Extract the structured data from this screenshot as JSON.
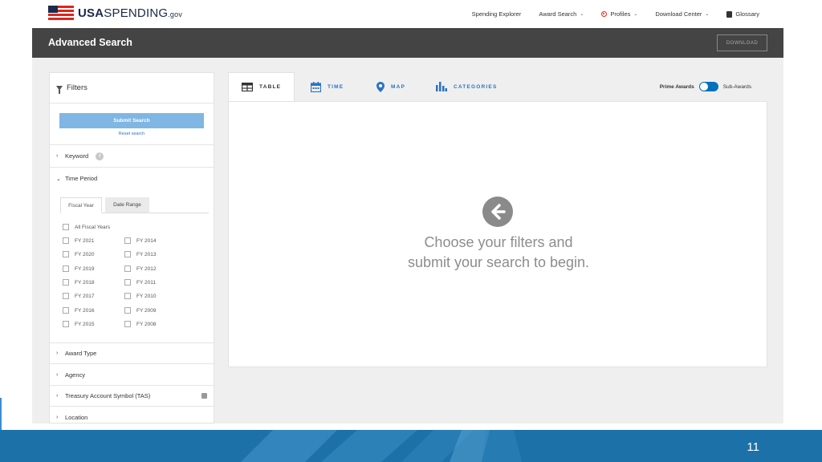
{
  "brand": {
    "bold": "USA",
    "name": "SPENDING",
    "tld": ".gov"
  },
  "nav": {
    "spending_explorer": "Spending Explorer",
    "award_search": "Award Search",
    "profiles": "Profiles",
    "download_center": "Download Center",
    "glossary": "Glossary"
  },
  "header": {
    "title": "Advanced Search",
    "download": "DOWNLOAD"
  },
  "sidebar": {
    "title": "Filters",
    "submit": "Submit Search",
    "reset": "Reset search",
    "keyword": "Keyword",
    "time_period": "Time Period",
    "tabs": {
      "fiscal_year": "Fiscal Year",
      "date_range": "Date Range"
    },
    "all_fy": "All Fiscal Years",
    "fy_left": [
      "FY 2021",
      "FY 2020",
      "FY 2019",
      "FY 2018",
      "FY 2017",
      "FY 2016",
      "FY 2015"
    ],
    "fy_right": [
      "FY 2014",
      "FY 2013",
      "FY 2012",
      "FY 2011",
      "FY 2010",
      "FY 2009",
      "FY 2008"
    ],
    "award_type": "Award Type",
    "agency": "Agency",
    "tas": "Treasury Account Symbol (TAS)",
    "location": "Location"
  },
  "tabs": {
    "table": "TABLE",
    "time": "TIME",
    "map": "MAP",
    "categories": "CATEGORIES"
  },
  "toggle": {
    "prime": "Prime Awards",
    "sub": "Sub-Awards"
  },
  "empty_state": {
    "line1": "Choose your filters and",
    "line2": "submit your search to begin."
  },
  "footer": {
    "page_number": "11"
  },
  "colors": {
    "accent": "#0071bc",
    "header": "#444444",
    "footer": "#1c72a8",
    "submit": "#7fb6e3"
  }
}
